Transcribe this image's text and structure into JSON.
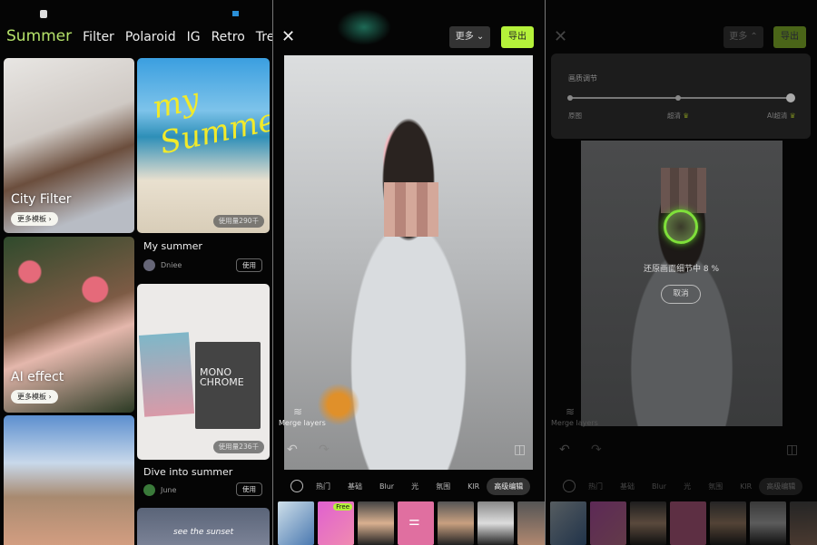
{
  "home": {
    "tabs": [
      {
        "label": "Summer",
        "active": true
      },
      {
        "label": "Filter"
      },
      {
        "label": "Polaroid"
      },
      {
        "label": "IG"
      },
      {
        "label": "Retro"
      },
      {
        "label": "Trending"
      }
    ],
    "left_cards": [
      {
        "title": "City Filter",
        "more": "更多模板 ›"
      },
      {
        "title": "AI effect",
        "more": "更多模板 ›"
      },
      {
        "title": ""
      }
    ],
    "right_cards": [
      {
        "title": "My summer",
        "author": "Dniee",
        "usage": "使用量290千",
        "use": "使用",
        "art_text": "my Summer"
      },
      {
        "title": "Dive into summer",
        "author": "June",
        "usage": "使用量236千",
        "use": "使用",
        "art_text": "MONO CHROME"
      },
      {
        "art_text": "see the sunset"
      }
    ]
  },
  "editor": {
    "more_label": "更多",
    "export_label": "导出",
    "merge_layers": "Merge layers",
    "categories": [
      "热门",
      "基础",
      "Blur",
      "光",
      "氛围",
      "KIR",
      "高级编辑"
    ],
    "active_category": "高级编辑",
    "free_badge": "Free",
    "accent": "#b5f23a"
  },
  "quality": {
    "title": "画质调节",
    "levels": [
      "原图",
      "超清",
      "AI超清"
    ],
    "selected": "AI超清",
    "progress_text": "还原画面细节中",
    "progress_percent": "8 %",
    "cancel": "取消"
  }
}
